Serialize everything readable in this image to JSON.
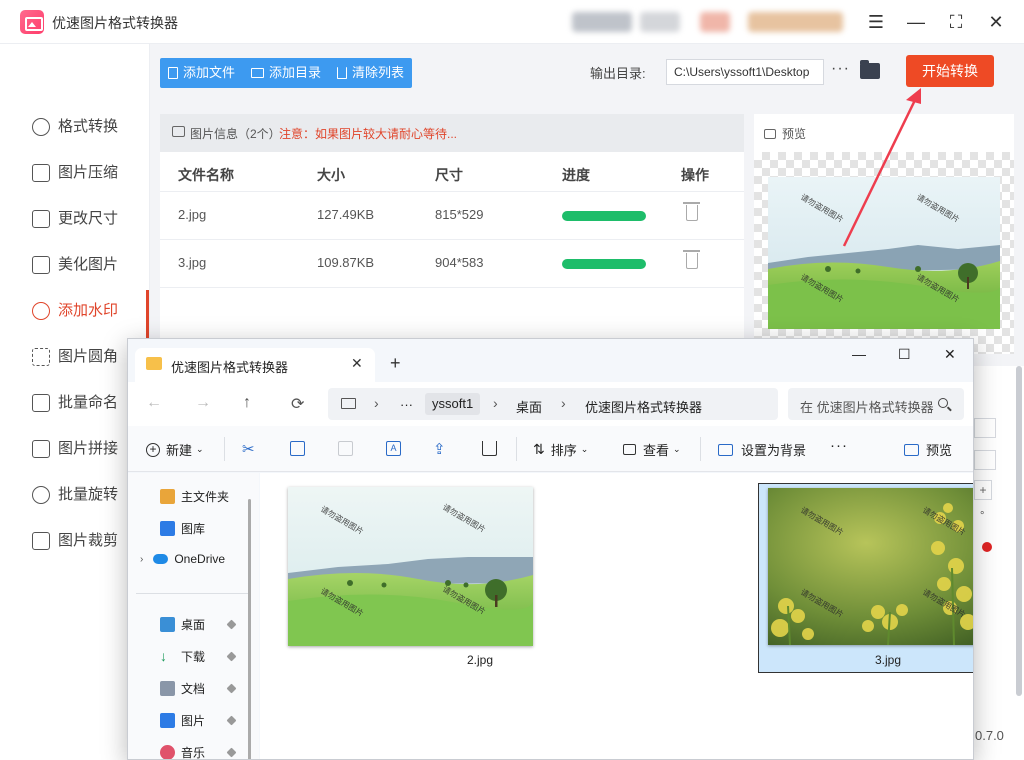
{
  "app": {
    "title": "优速图片格式转换器",
    "window_controls": {
      "menu": "☰",
      "minimize": "—",
      "maximize": "⛶",
      "close": "✕"
    }
  },
  "sidebar": {
    "items": [
      {
        "label": "格式转换",
        "icon": "format-convert-icon"
      },
      {
        "label": "图片压缩",
        "icon": "compress-icon"
      },
      {
        "label": "更改尺寸",
        "icon": "resize-icon"
      },
      {
        "label": "美化图片",
        "icon": "beautify-icon"
      },
      {
        "label": "添加水印",
        "icon": "watermark-icon",
        "active": true
      },
      {
        "label": "图片圆角",
        "icon": "round-corner-icon"
      },
      {
        "label": "批量命名",
        "icon": "rename-icon"
      },
      {
        "label": "图片拼接",
        "icon": "stitch-icon"
      },
      {
        "label": "批量旋转",
        "icon": "rotate-icon"
      },
      {
        "label": "图片裁剪",
        "icon": "crop-icon"
      }
    ]
  },
  "toolbar": {
    "add_file": "添加文件",
    "add_folder": "添加目录",
    "clear_list": "清除列表"
  },
  "output": {
    "label": "输出目录:",
    "path": "C:\\Users\\yssoft1\\Desktop",
    "more": "···",
    "start_button": "开始转换"
  },
  "file_info": {
    "title": "图片信息（2个）",
    "warning": "注意：如果图片较大请耐心等待...",
    "columns": [
      "文件名称",
      "大小",
      "尺寸",
      "进度",
      "操作"
    ],
    "rows": [
      {
        "name": "2.jpg",
        "size": "127.49KB",
        "dims": "815*529",
        "progress": 1.0
      },
      {
        "name": "3.jpg",
        "size": "109.87KB",
        "dims": "904*583",
        "progress": 1.0
      }
    ]
  },
  "preview": {
    "label": "预览",
    "watermark_text": "请勿盗用图片"
  },
  "right_panel": {
    "unit_degree": "°",
    "plus": "+"
  },
  "version": "0.7.0",
  "explorer": {
    "tab_title": "优速图片格式转换器",
    "tab_close": "✕",
    "new_tab": "+",
    "controls": {
      "minimize": "—",
      "maximize": "☐",
      "close": "✕"
    },
    "nav": {
      "back": "←",
      "forward": "→",
      "up": "↑",
      "refresh": "⟳"
    },
    "breadcrumb": [
      "yssoft1",
      "桌面",
      "优速图片格式转换器"
    ],
    "breadcrumb_more": "···",
    "search_placeholder": "在 优速图片格式转换器 中搜索",
    "commands": {
      "new": "新建",
      "sort": "排序",
      "view": "查看",
      "set_background": "设置为背景",
      "more": "···",
      "preview": "预览"
    },
    "nav_pane": [
      {
        "label": "主文件夹",
        "icon": "home-icon"
      },
      {
        "label": "图库",
        "icon": "gallery-icon"
      },
      {
        "label": "OneDrive",
        "icon": "onedrive-icon",
        "expandable": true
      },
      {
        "label": "桌面",
        "icon": "desktop-icon",
        "pinned": true
      },
      {
        "label": "下载",
        "icon": "download-icon",
        "pinned": true
      },
      {
        "label": "文档",
        "icon": "documents-icon",
        "pinned": true
      },
      {
        "label": "图片",
        "icon": "pictures-icon",
        "pinned": true
      },
      {
        "label": "音乐",
        "icon": "music-icon",
        "pinned": true
      }
    ],
    "files": [
      {
        "name": "2.jpg",
        "selected": false
      },
      {
        "name": "3.jpg",
        "selected": true
      }
    ]
  },
  "colors": {
    "accent_red": "#ee4a25",
    "toolbar_blue": "#3d9af0",
    "progress_green": "#1ebd6a",
    "active_sidebar": "#e0452b"
  }
}
